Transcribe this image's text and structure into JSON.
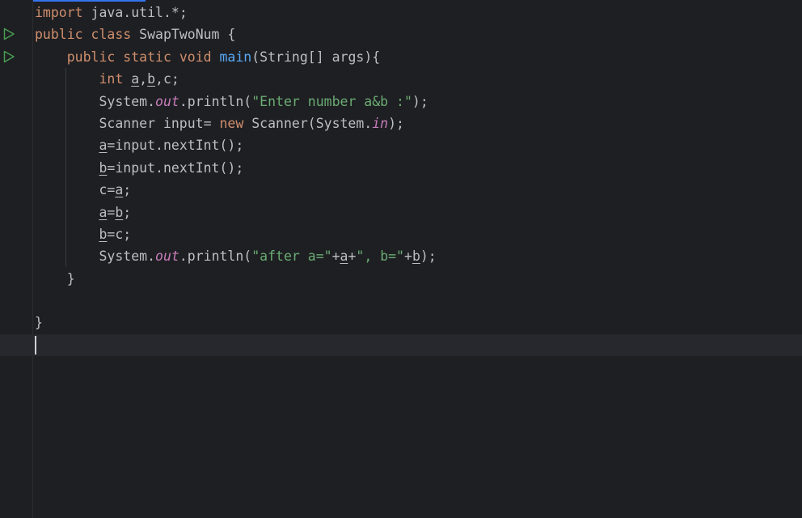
{
  "editor": {
    "lines": [
      [
        {
          "t": "kw",
          "v": "import"
        },
        {
          "t": "plain",
          "v": " java.util.*;"
        }
      ],
      [
        {
          "t": "kw",
          "v": "public class"
        },
        {
          "t": "plain",
          "v": " SwapTwoNum {"
        }
      ],
      [
        {
          "t": "plain",
          "v": "    "
        },
        {
          "t": "kw",
          "v": "public static void"
        },
        {
          "t": "plain",
          "v": " "
        },
        {
          "t": "fn",
          "v": "main"
        },
        {
          "t": "plain",
          "v": "(String[] args){"
        }
      ],
      [
        {
          "t": "plain",
          "v": "        "
        },
        {
          "t": "kw",
          "v": "int"
        },
        {
          "t": "plain",
          "v": " "
        },
        {
          "t": "var",
          "v": "a"
        },
        {
          "t": "plain",
          "v": ","
        },
        {
          "t": "var",
          "v": "b"
        },
        {
          "t": "plain",
          "v": ",c;"
        }
      ],
      [
        {
          "t": "plain",
          "v": "        System."
        },
        {
          "t": "field",
          "v": "out"
        },
        {
          "t": "plain",
          "v": ".println("
        },
        {
          "t": "str",
          "v": "\"Enter number a&b :\""
        },
        {
          "t": "plain",
          "v": ");"
        }
      ],
      [
        {
          "t": "plain",
          "v": "        Scanner input= "
        },
        {
          "t": "kw",
          "v": "new"
        },
        {
          "t": "plain",
          "v": " Scanner(System."
        },
        {
          "t": "field",
          "v": "in"
        },
        {
          "t": "plain",
          "v": ");"
        }
      ],
      [
        {
          "t": "plain",
          "v": "        "
        },
        {
          "t": "var",
          "v": "a"
        },
        {
          "t": "plain",
          "v": "=input.nextInt();"
        }
      ],
      [
        {
          "t": "plain",
          "v": "        "
        },
        {
          "t": "var",
          "v": "b"
        },
        {
          "t": "plain",
          "v": "=input.nextInt();"
        }
      ],
      [
        {
          "t": "plain",
          "v": "        c="
        },
        {
          "t": "var",
          "v": "a"
        },
        {
          "t": "plain",
          "v": ";"
        }
      ],
      [
        {
          "t": "plain",
          "v": "        "
        },
        {
          "t": "var",
          "v": "a"
        },
        {
          "t": "plain",
          "v": "="
        },
        {
          "t": "var",
          "v": "b"
        },
        {
          "t": "plain",
          "v": ";"
        }
      ],
      [
        {
          "t": "plain",
          "v": "        "
        },
        {
          "t": "var",
          "v": "b"
        },
        {
          "t": "plain",
          "v": "=c;"
        }
      ],
      [
        {
          "t": "plain",
          "v": "        System."
        },
        {
          "t": "field",
          "v": "out"
        },
        {
          "t": "plain",
          "v": ".println("
        },
        {
          "t": "str",
          "v": "\"after a=\""
        },
        {
          "t": "plain",
          "v": "+"
        },
        {
          "t": "var",
          "v": "a"
        },
        {
          "t": "plain",
          "v": "+"
        },
        {
          "t": "str",
          "v": "\", b=\""
        },
        {
          "t": "plain",
          "v": "+"
        },
        {
          "t": "var",
          "v": "b"
        },
        {
          "t": "plain",
          "v": ");"
        }
      ],
      [
        {
          "t": "plain",
          "v": "    }"
        }
      ],
      [
        {
          "t": "plain",
          "v": ""
        }
      ],
      [
        {
          "t": "plain",
          "v": "}"
        }
      ],
      [
        {
          "t": "plain",
          "v": ""
        }
      ]
    ],
    "run_markers": [
      "play-icon",
      "play-icon"
    ]
  },
  "colors": {
    "background": "#1e1f22",
    "keyword": "#cf8e6d",
    "function": "#56a8f5",
    "string": "#6aab73",
    "static_field": "#c77dbb",
    "plain": "#bcbec4",
    "run_icon": "#499c54"
  }
}
